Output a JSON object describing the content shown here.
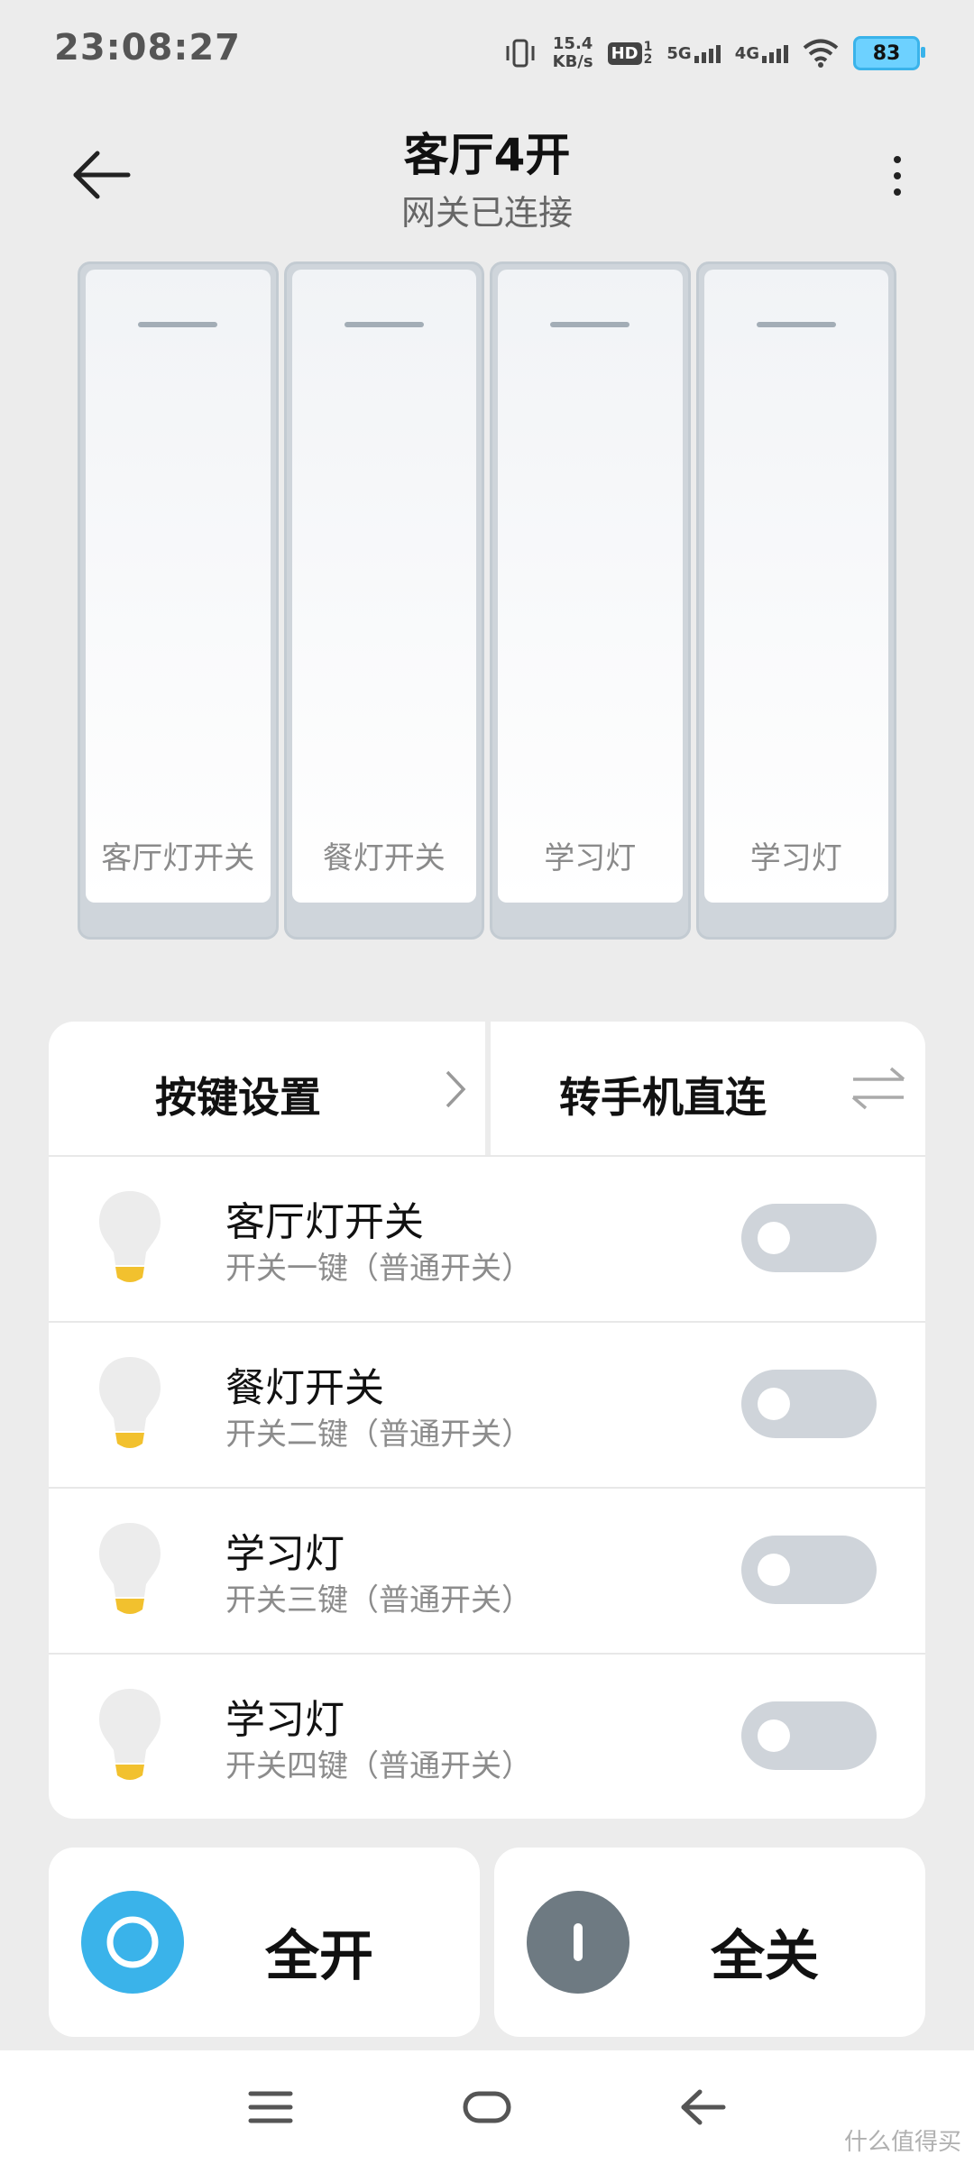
{
  "status_bar": {
    "time": "23:08:27",
    "speed_value": "15.4",
    "speed_unit": "KB/s",
    "hd_label": "HD",
    "hd_sub_top": "1",
    "hd_sub_bottom": "2",
    "net1_label": "5G",
    "net2_label": "4G",
    "battery": "83"
  },
  "header": {
    "title": "客厅4开",
    "subtitle": "网关已连接"
  },
  "switch_panel": {
    "keys": [
      {
        "label": "客厅灯开关"
      },
      {
        "label": "餐灯开关"
      },
      {
        "label": "学习灯"
      },
      {
        "label": "学习灯"
      }
    ]
  },
  "card": {
    "key_settings_label": "按键设置",
    "direct_connect_label": "转手机直连",
    "rows": [
      {
        "name": "客厅灯开关",
        "desc": "开关一键（普通开关）",
        "on": false
      },
      {
        "name": "餐灯开关",
        "desc": "开关二键（普通开关）",
        "on": false
      },
      {
        "name": "学习灯",
        "desc": "开关三键（普通开关）",
        "on": false
      },
      {
        "name": "学习灯",
        "desc": "开关四键（普通开关）",
        "on": false
      }
    ]
  },
  "actions": {
    "all_on_label": "全开",
    "all_off_label": "全关"
  },
  "colors": {
    "accent": "#3ab3ea",
    "off_gray": "#6e7a82",
    "toggle_off": "#cfd4da"
  },
  "watermark": "什么值得买"
}
